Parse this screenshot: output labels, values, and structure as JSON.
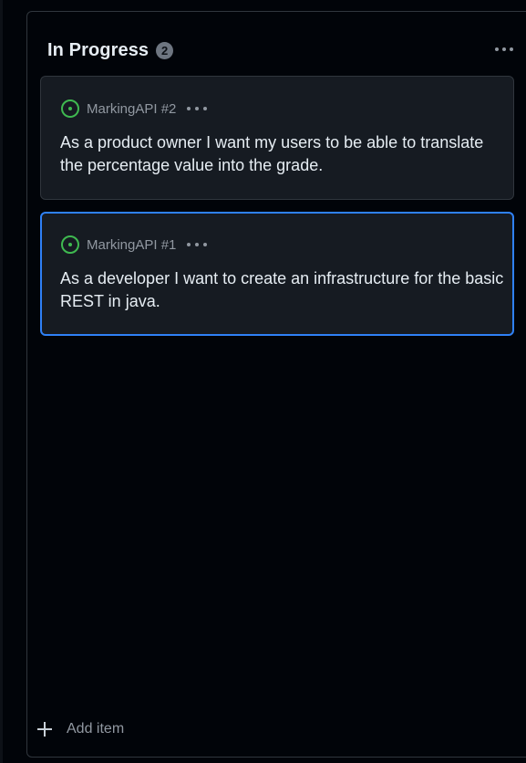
{
  "column": {
    "title": "In Progress",
    "count": "2",
    "add_item_label": "Add item"
  },
  "cards": [
    {
      "repo_ref": "MarkingAPI #2",
      "title": "As a product owner I want my users to be able to translate the percentage value into the grade.",
      "selected": false,
      "status_icon": "issue-opened-icon"
    },
    {
      "repo_ref": "MarkingAPI #1",
      "title": "As a developer I want to create an infrastructure for the basic REST in java.",
      "selected": true,
      "status_icon": "issue-opened-icon"
    }
  ],
  "colors": {
    "background": "#010409",
    "card_background": "#161b22",
    "border": "#30363d",
    "selected_border": "#2f81f7",
    "open_status": "#3fb950",
    "text_primary": "#e6edf3",
    "text_muted": "#9198a1"
  }
}
